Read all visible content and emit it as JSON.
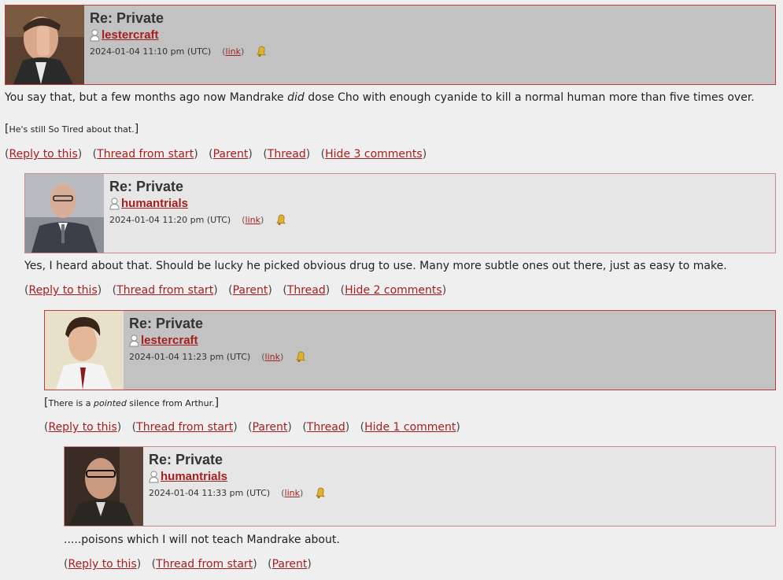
{
  "comments": [
    {
      "subject": "Re: Private",
      "username": "lestercraft",
      "date": "2024-01-04 11:10 pm (UTC)",
      "link_label": "link",
      "body": "You say that, but a few months ago now Mandrake ",
      "body_em": "did",
      "body_after": " dose Cho with enough cyanide to kill a normal human more than five times over.",
      "note_open": "[",
      "note": "He's still So Tired about that.",
      "note_close": "]",
      "actions": [
        "Reply to this",
        "Thread from start",
        "Parent",
        "Thread",
        "Hide 3 comments"
      ]
    },
    {
      "subject": "Re: Private",
      "username": "humantrials",
      "date": "2024-01-04 11:20 pm (UTC)",
      "link_label": "link",
      "body": "Yes, I heard about that. Should be lucky he picked obvious drug to use. Many more subtle ones out there, just as easy to make.",
      "actions": [
        "Reply to this",
        "Thread from start",
        "Parent",
        "Thread",
        "Hide 2 comments"
      ]
    },
    {
      "subject": "Re: Private",
      "username": "lestercraft",
      "date": "2024-01-04 11:23 pm (UTC)",
      "link_label": "link",
      "note_open": "[",
      "note_before": "There is a ",
      "note_em": "pointed",
      "note_after": " silence from Arthur.",
      "note_close": "]",
      "actions": [
        "Reply to this",
        "Thread from start",
        "Parent",
        "Thread",
        "Hide 1 comment"
      ]
    },
    {
      "subject": "Re: Private",
      "username": "humantrials",
      "date": "2024-01-04 11:33 pm (UTC)",
      "link_label": "link",
      "body": ".....poisons which I will not teach Mandrake about.",
      "actions": [
        "Reply to this",
        "Thread from start",
        "Parent"
      ]
    }
  ],
  "icons": {
    "user": "user-icon",
    "bell": "bell-icon"
  },
  "colors": {
    "link": "#a61e1e",
    "header_dark": "#c2c2c2",
    "header_light": "#e6e6e6",
    "background": "#efefef"
  }
}
